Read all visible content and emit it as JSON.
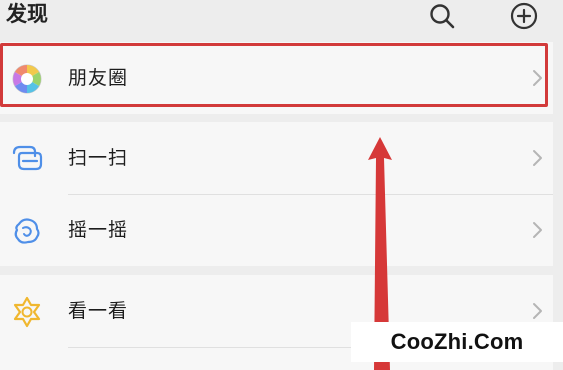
{
  "header": {
    "title": "发现",
    "search_icon": "search-icon",
    "add_icon": "plus-circle-icon"
  },
  "menu": {
    "moments": {
      "label": "朋友圈",
      "icon": "moments-aperture-icon"
    },
    "scan": {
      "label": "扫一扫",
      "icon": "scan-icon"
    },
    "shake": {
      "label": "摇一摇",
      "icon": "shake-icon"
    },
    "top_stories": {
      "label": "看一看",
      "icon": "top-stories-icon"
    }
  },
  "annotation": {
    "highlight_color": "#d23a3a",
    "arrow_color": "#d23a3a"
  },
  "watermark": {
    "text": "CooZhi.Com"
  }
}
